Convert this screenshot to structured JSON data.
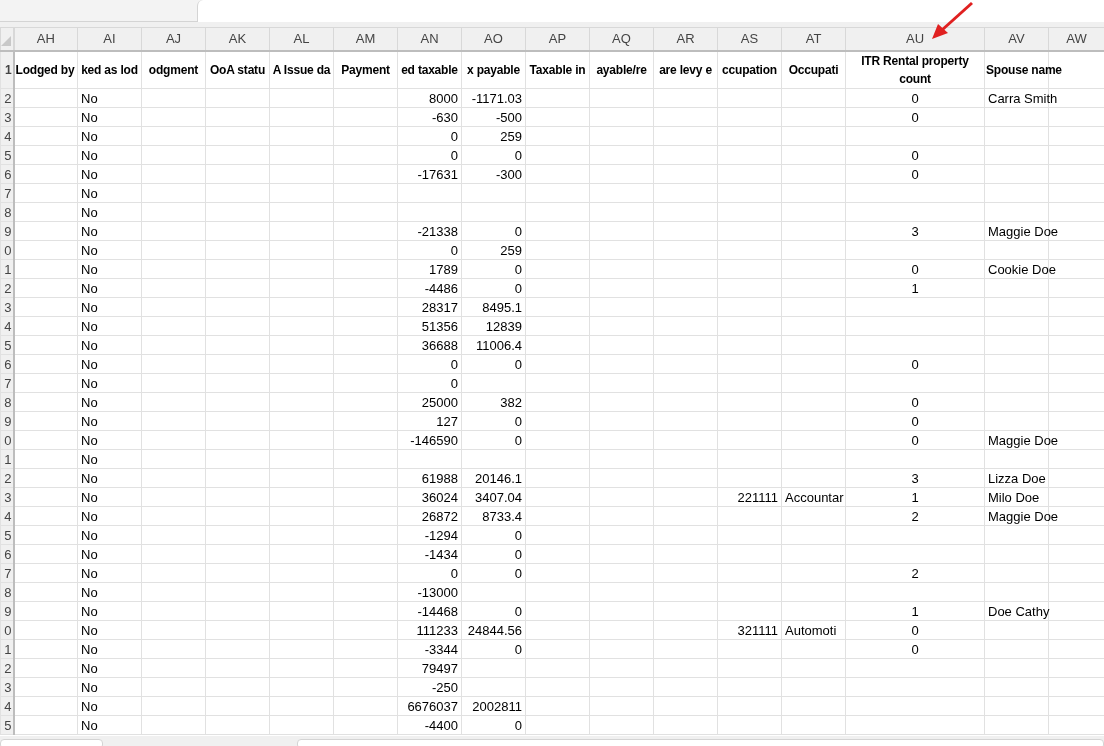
{
  "columns": [
    {
      "letter": "AH",
      "header": "Lodged by"
    },
    {
      "letter": "AI",
      "header": "ked as lod"
    },
    {
      "letter": "AJ",
      "header": "odgment"
    },
    {
      "letter": "AK",
      "header": "OoA statu"
    },
    {
      "letter": "AL",
      "header": "A Issue da"
    },
    {
      "letter": "AM",
      "header": "Payment"
    },
    {
      "letter": "AN",
      "header": "ed taxable"
    },
    {
      "letter": "AO",
      "header": "x payable"
    },
    {
      "letter": "AP",
      "header": "Taxable in"
    },
    {
      "letter": "AQ",
      "header": "ayable/re"
    },
    {
      "letter": "AR",
      "header": "are levy e"
    },
    {
      "letter": "AS",
      "header": "ccupation"
    },
    {
      "letter": "AT",
      "header": "Occupati"
    },
    {
      "letter": "AU",
      "header": "ITR Rental property count"
    },
    {
      "letter": "AV",
      "header": "Spouse name"
    },
    {
      "letter": "AW"
    }
  ],
  "header_row_number": "1",
  "rows": [
    {
      "row_number": "2",
      "cells": {
        "AI": "No",
        "AN": "8000",
        "AO": "-1171.03",
        "AU": "0",
        "AV": "Carra Smith"
      }
    },
    {
      "row_number": "3",
      "cells": {
        "AI": "No",
        "AN": "-630",
        "AO": "-500",
        "AU": "0"
      }
    },
    {
      "row_number": "4",
      "cells": {
        "AI": "No",
        "AN": "0",
        "AO": "259"
      }
    },
    {
      "row_number": "5",
      "cells": {
        "AI": "No",
        "AN": "0",
        "AO": "0",
        "AU": "0"
      }
    },
    {
      "row_number": "6",
      "cells": {
        "AI": "No",
        "AN": "-17631",
        "AO": "-300",
        "AU": "0"
      }
    },
    {
      "row_number": "7",
      "cells": {
        "AI": "No"
      }
    },
    {
      "row_number": "8",
      "cells": {
        "AI": "No"
      }
    },
    {
      "row_number": "9",
      "cells": {
        "AI": "No",
        "AN": "-21338",
        "AO": "0",
        "AU": "3",
        "AV": "Maggie Doe"
      }
    },
    {
      "row_number": "0",
      "cells": {
        "AI": "No",
        "AN": "0",
        "AO": "259"
      }
    },
    {
      "row_number": "1",
      "cells": {
        "AI": "No",
        "AN": "1789",
        "AO": "0",
        "AU": "0",
        "AV": "Cookie Doe"
      }
    },
    {
      "row_number": "2",
      "cells": {
        "AI": "No",
        "AN": "-4486",
        "AO": "0",
        "AU": "1"
      }
    },
    {
      "row_number": "3",
      "cells": {
        "AI": "No",
        "AN": "28317",
        "AO": "8495.1"
      }
    },
    {
      "row_number": "4",
      "cells": {
        "AI": "No",
        "AN": "51356",
        "AO": "12839"
      }
    },
    {
      "row_number": "5",
      "cells": {
        "AI": "No",
        "AN": "36688",
        "AO": "11006.4"
      }
    },
    {
      "row_number": "6",
      "cells": {
        "AI": "No",
        "AN": "0",
        "AO": "0",
        "AU": "0"
      }
    },
    {
      "row_number": "7",
      "cells": {
        "AI": "No",
        "AN": "0"
      }
    },
    {
      "row_number": "8",
      "cells": {
        "AI": "No",
        "AN": "25000",
        "AO": "382",
        "AU": "0"
      }
    },
    {
      "row_number": "9",
      "cells": {
        "AI": "No",
        "AN": "127",
        "AO": "0",
        "AU": "0"
      }
    },
    {
      "row_number": "0",
      "cells": {
        "AI": "No",
        "AN": "-146590",
        "AO": "0",
        "AU": "0",
        "AV": "Maggie Doe"
      }
    },
    {
      "row_number": "1",
      "cells": {
        "AI": "No"
      }
    },
    {
      "row_number": "2",
      "cells": {
        "AI": "No",
        "AN": "61988",
        "AO": "20146.1",
        "AU": "3",
        "AV": "Lizza Doe"
      }
    },
    {
      "row_number": "3",
      "cells": {
        "AI": "No",
        "AN": "36024",
        "AO": "3407.04",
        "AS": "221111",
        "AT": "Accountar",
        "AU": "1",
        "AV": "Milo Doe"
      }
    },
    {
      "row_number": "4",
      "cells": {
        "AI": "No",
        "AN": "26872",
        "AO": "8733.4",
        "AU": "2",
        "AV": "Maggie Doe"
      }
    },
    {
      "row_number": "5",
      "cells": {
        "AI": "No",
        "AN": "-1294",
        "AO": "0"
      }
    },
    {
      "row_number": "6",
      "cells": {
        "AI": "No",
        "AN": "-1434",
        "AO": "0"
      }
    },
    {
      "row_number": "7",
      "cells": {
        "AI": "No",
        "AN": "0",
        "AO": "0",
        "AU": "2"
      }
    },
    {
      "row_number": "8",
      "cells": {
        "AI": "No",
        "AN": "-13000"
      }
    },
    {
      "row_number": "9",
      "cells": {
        "AI": "No",
        "AN": "-14468",
        "AO": "0",
        "AU": "1",
        "AV": "Doe Cathy"
      }
    },
    {
      "row_number": "0",
      "cells": {
        "AI": "No",
        "AN": "111233",
        "AO": "24844.56",
        "AS": "321111",
        "AT": "Automoti",
        "AU": "0"
      }
    },
    {
      "row_number": "1",
      "cells": {
        "AI": "No",
        "AN": "-3344",
        "AO": "0",
        "AU": "0"
      }
    },
    {
      "row_number": "2",
      "cells": {
        "AI": "No",
        "AN": "79497"
      }
    },
    {
      "row_number": "3",
      "cells": {
        "AI": "No",
        "AN": "-250"
      }
    },
    {
      "row_number": "4",
      "cells": {
        "AI": "No",
        "AN": "6676037",
        "AO": "2002811"
      }
    },
    {
      "row_number": "5",
      "cells": {
        "AI": "No",
        "AN": "-4400",
        "AO": "0"
      }
    }
  ]
}
